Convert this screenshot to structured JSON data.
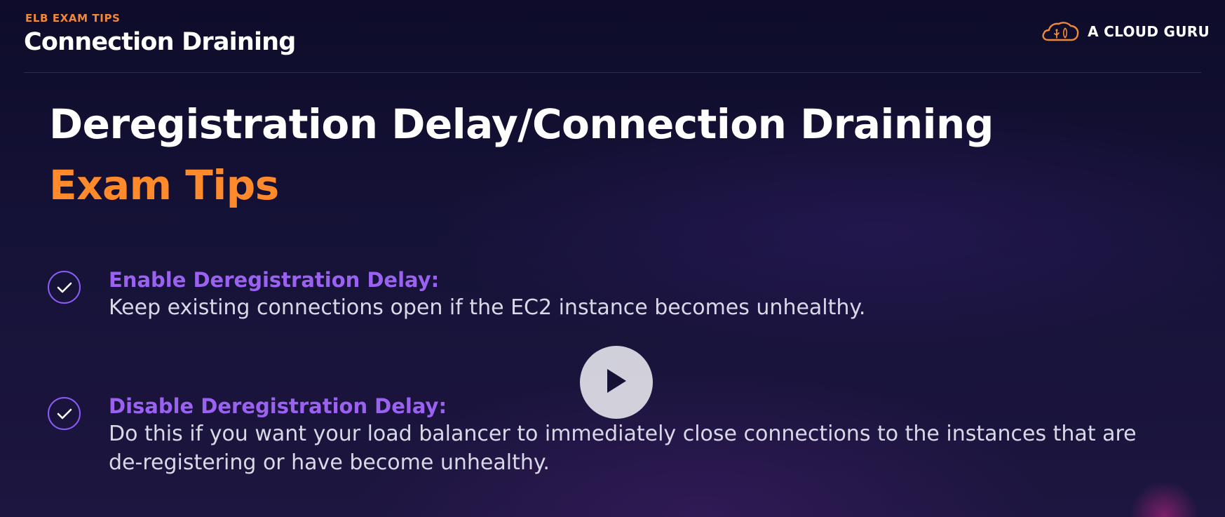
{
  "header": {
    "eyebrow": "ELB EXAM TIPS",
    "title": "Connection Draining"
  },
  "brand": {
    "name": "A CLOUD GURU",
    "icon": "cloud-guru-logo-icon",
    "color": "#f0883a"
  },
  "slide": {
    "title": "Deregistration Delay/Connection Draining",
    "subtitle": "Exam Tips",
    "tips": [
      {
        "icon": "check-circle-icon",
        "heading": "Enable Deregistration Delay:",
        "text": "Keep existing connections open if the EC2 instance becomes unhealthy."
      },
      {
        "icon": "check-circle-icon",
        "heading": "Disable Deregistration Delay:",
        "text": "Do this if you want your load balancer to immediately close connections to the instances that are de-registering or have become unhealthy."
      }
    ]
  },
  "player": {
    "play_icon": "play-icon"
  },
  "colors": {
    "accent_orange": "#ff8a2b",
    "accent_purple": "#9b62f2",
    "background": "#151237"
  }
}
